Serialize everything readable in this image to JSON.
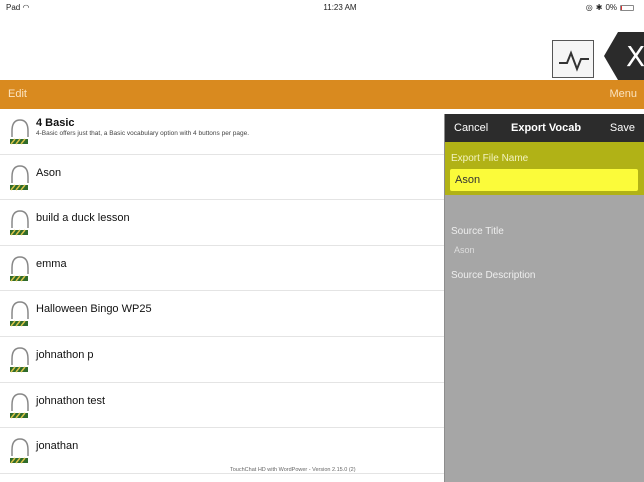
{
  "status_bar": {
    "left": "Pad",
    "time": "11:23 AM",
    "right": "0%"
  },
  "toolbar": {
    "edit_label": "Edit",
    "menu_label": "Menu",
    "bar_color": "#d98a1f"
  },
  "vocab_list": {
    "items": [
      {
        "title": "4 Basic",
        "subtitle": "4-Basic offers just that, a Basic vocabulary option with 4 buttons per page."
      },
      {
        "title": "Ason"
      },
      {
        "title": "build a duck lesson"
      },
      {
        "title": "emma"
      },
      {
        "title": "Halloween Bingo WP25"
      },
      {
        "title": "johnathon p"
      },
      {
        "title": "johnathon test"
      },
      {
        "title": "jonathan"
      }
    ],
    "footer": "TouchChat HD with WordPower - Version 2.15.0 (2)"
  },
  "export_panel": {
    "cancel_label": "Cancel",
    "title": "Export Vocab",
    "save_label": "Save",
    "file_name_label": "Export File Name",
    "file_name_value": "Ason",
    "source_title_label": "Source Title",
    "source_title_value": "Ason",
    "source_description_label": "Source Description",
    "highlight_color": "#b1b216",
    "input_color": "#fbfb3a"
  },
  "icons": {
    "vocab_file": "vocab-file-icon",
    "app_logo": "x-logo-icon",
    "waveform": "waveform-icon"
  }
}
